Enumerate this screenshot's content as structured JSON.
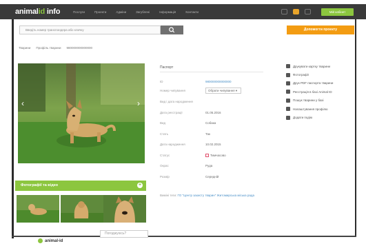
{
  "header": {
    "logo_text": "animal",
    "logo_id": "id",
    "logo_suffix": " info",
    "nav": [
      "Послуги",
      "Проекти",
      "Адміни",
      "Загублені",
      "Інформація",
      "Контакти"
    ],
    "cabinet_label": "Мій кабінет"
  },
  "search": {
    "placeholder": "Введіть номер транспондера або кличку",
    "help_label": "Допомогти проекту"
  },
  "breadcrumb": [
    "Тварини",
    "Профіль тварини",
    "980000000000000"
  ],
  "gallery": {
    "title": "Фотографії та відео"
  },
  "info": {
    "title": "Паспорт",
    "rows": [
      {
        "label": "ID",
        "value": "980000000000000"
      },
      {
        "label": "Номер чипування",
        "value": "Обрати чипування"
      },
      {
        "label": "Вид і дата народження",
        "value": ""
      },
      {
        "label": "Дата реєстрації",
        "value": "01.05.2016"
      },
      {
        "label": "Вид",
        "value": "Собака"
      },
      {
        "label": "Стать",
        "value": "Так"
      },
      {
        "label": "Дата народження",
        "value": "10.02.2015"
      },
      {
        "label": "Статус",
        "value": "Тимчасово"
      },
      {
        "label": "Окрас",
        "value": "Руда"
      },
      {
        "label": "Розмір",
        "value": "Середній"
      }
    ],
    "tags_label": "Виміні теги:",
    "tags_link": "ГО \"Центр захисту тварин\" Житомирська міська рада"
  },
  "actions": [
    {
      "icon": "print-icon",
      "label": "Друкувати картку тварини"
    },
    {
      "icon": "image-icon",
      "label": "Фотографії"
    },
    {
      "icon": "pdf-icon",
      "label": "Друк PDF паспорта тварини"
    },
    {
      "icon": "document-icon",
      "label": "Реєстрація в базі Animal ID"
    },
    {
      "icon": "search-icon",
      "label": "Пошук тварини у базі"
    },
    {
      "icon": "gear-icon",
      "label": "Налаштування профілю"
    },
    {
      "icon": "calendar-icon",
      "label": "Додати подію"
    }
  ],
  "cookie_label": "Погоджуюсь?",
  "footer": {
    "logo_text": "animal-id"
  }
}
